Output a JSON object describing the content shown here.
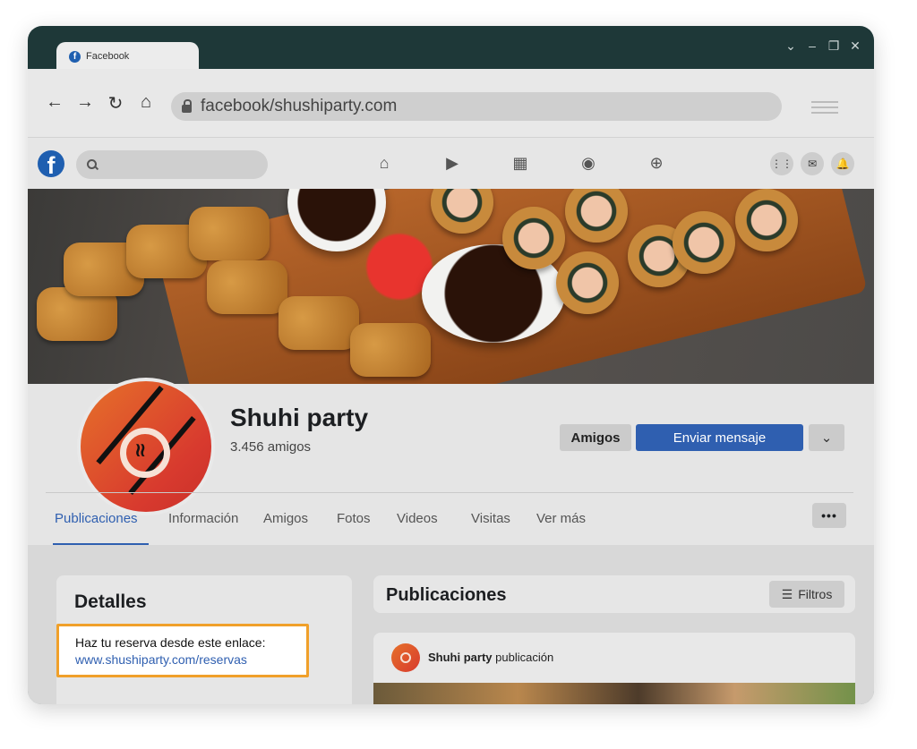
{
  "browser": {
    "tab_title": "Facebook",
    "url": "facebook/shushiparty.com",
    "window_controls": [
      "chevron-down-icon",
      "minimize-icon",
      "restore-icon",
      "close-icon"
    ]
  },
  "facebook_bar": {
    "nav_icons": [
      "home-icon",
      "video-icon",
      "marketplace-icon",
      "groups-icon",
      "gaming-icon"
    ],
    "right_icons": [
      "apps-grid-icon",
      "messenger-icon",
      "notifications-icon"
    ]
  },
  "profile": {
    "name": "Shuhi party",
    "friends": "3.456 amigos",
    "buttons": {
      "friends": "Amigos",
      "message": "Enviar mensaje",
      "more": "⌄"
    }
  },
  "tabs": [
    "Publicaciones",
    "Información",
    "Amigos",
    "Fotos",
    "Videos",
    "Visitas",
    "Ver más"
  ],
  "more_dots": "•••",
  "details": {
    "title": "Detalles",
    "reservation_text": "Haz tu reserva desde este enlace:",
    "reservation_link": "www.shushiparty.com/reservas"
  },
  "posts": {
    "title": "Publicaciones",
    "filters_label": "Filtros",
    "author": "Shuhi party",
    "action": "publicación"
  },
  "colors": {
    "window_frame": "#1e3838",
    "facebook_blue": "#2f5fb0",
    "highlight_border": "#f0a02a",
    "avatar_gradient_start": "#e6712a",
    "avatar_gradient_end": "#d83a2e"
  }
}
